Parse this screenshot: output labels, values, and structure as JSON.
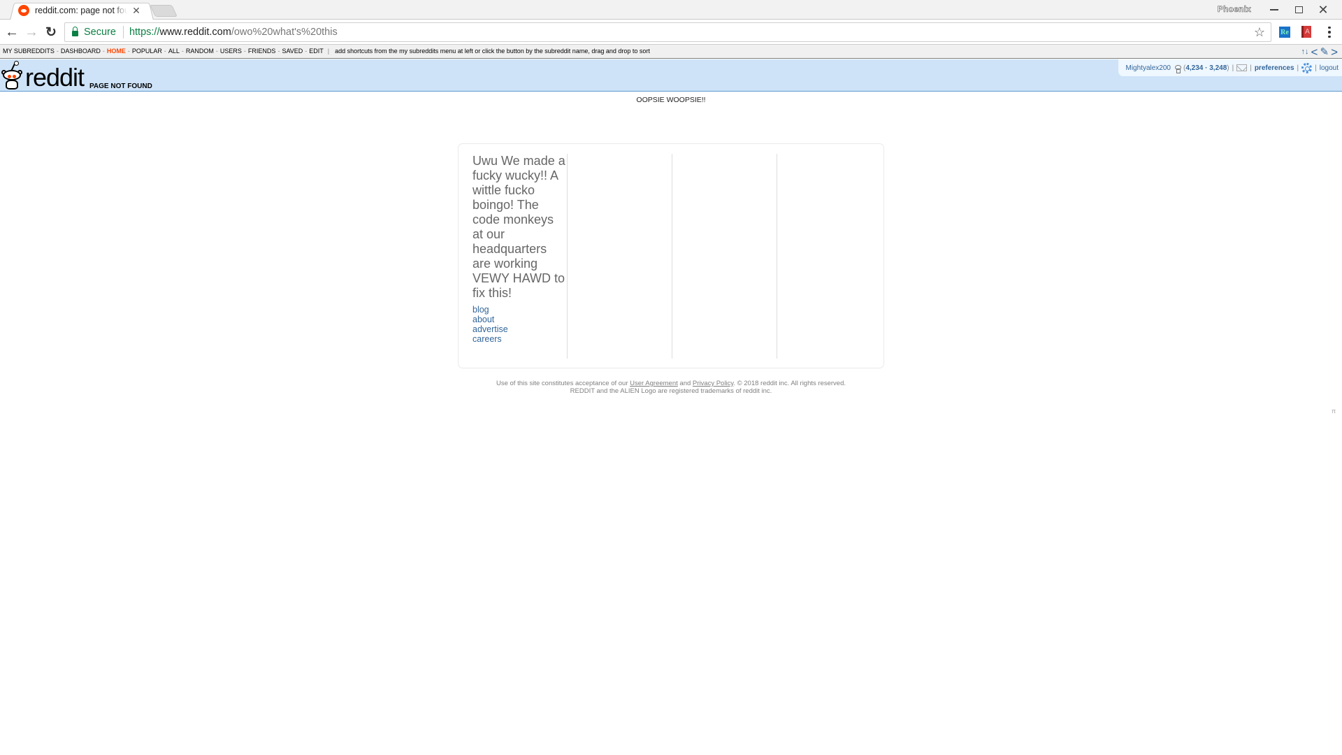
{
  "browser": {
    "tab_title": "reddit.com: page not found",
    "profile_name": "Phoenix",
    "secure_label": "Secure",
    "url_scheme": "https://",
    "url_host": "www.reddit.com",
    "url_path": "/owo%20what's%20this",
    "icons": {
      "back": "←",
      "forward": "→",
      "reload": "↻",
      "star": "☆",
      "close_tab": "✕",
      "window_close": "✕",
      "ext_re": "Re",
      "ext_a": "A"
    }
  },
  "subreddit_bar": {
    "items": [
      {
        "label": "MY SUBREDDITS",
        "selected": false
      },
      {
        "label": "DASHBOARD",
        "selected": false
      },
      {
        "label": "HOME",
        "selected": true
      },
      {
        "label": "POPULAR",
        "selected": false
      },
      {
        "label": "ALL",
        "selected": false
      },
      {
        "label": "RANDOM",
        "selected": false
      },
      {
        "label": "USERS",
        "selected": false
      },
      {
        "label": "FRIENDS",
        "selected": false
      },
      {
        "label": "SAVED",
        "selected": false
      },
      {
        "label": "EDIT",
        "selected": false
      }
    ],
    "separator": "-",
    "hint": "add shortcuts from the my subreddits menu at left or click the button by the subreddit name, drag and drop to sort",
    "tools": {
      "sort": "↑↓",
      "prev": "<",
      "edit": "✎",
      "next": ">"
    }
  },
  "header": {
    "wordmark": "reddit",
    "page_name": "PAGE NOT FOUND",
    "user": {
      "username": "Mightyalex200",
      "karma_post": "4,234",
      "karma_comment": "3,248",
      "preferences_label": "preferences",
      "logout_label": "logout"
    }
  },
  "main": {
    "heading": "OOPSIE WOOPSIE!!",
    "tagline": "Uwu We made a fucky wucky!! A wittle fucko boingo! The code monkeys at our headquarters are working VEWY HAWD to fix this!",
    "links": [
      "blog",
      "about",
      "advertise",
      "careers"
    ]
  },
  "legal": {
    "line1_prefix": "Use of this site constitutes acceptance of our",
    "user_agreement": "User Agreement",
    "and": "and",
    "privacy_policy": "Privacy Policy",
    "line1_suffix": ". © 2018 reddit inc. All rights reserved.",
    "line2": "REDDIT and the ALIEN Logo are registered trademarks of reddit inc."
  },
  "misc": {
    "pi_symbol": "π"
  },
  "colors": {
    "header_bg": "#cee3f8",
    "header_border": "#5f99cf",
    "link": "#336699",
    "selected_nav": "#ff4500",
    "secure_green": "#0b8043"
  }
}
